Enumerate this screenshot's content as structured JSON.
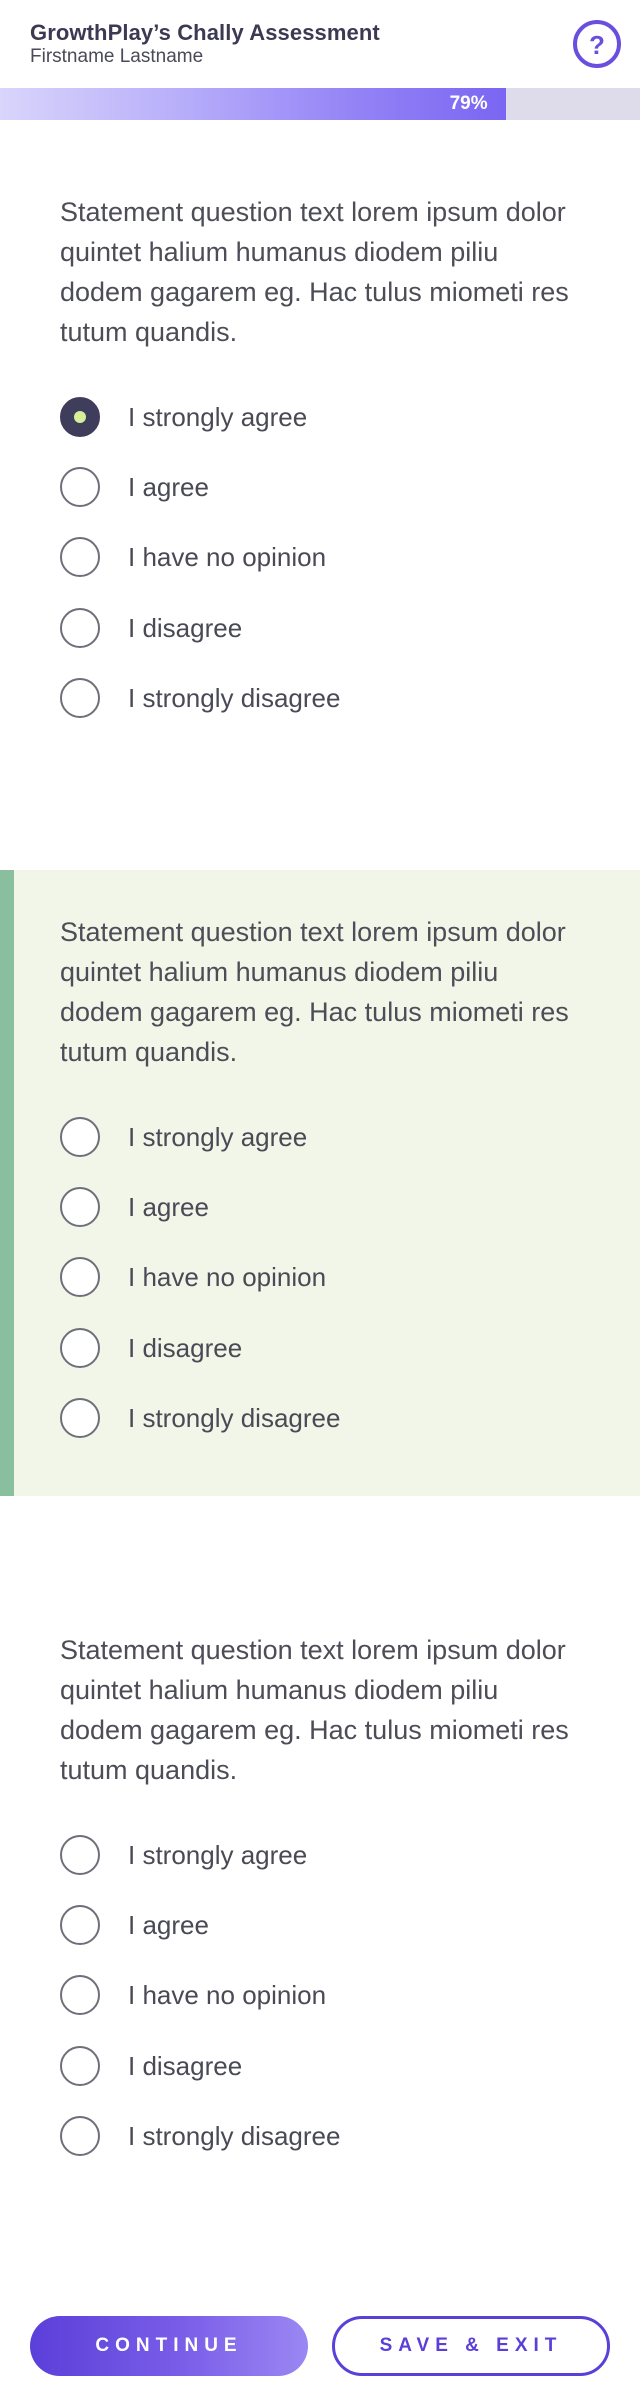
{
  "header": {
    "title": "GrowthPlay’s Chally Assessment",
    "user_name": "Firstname Lastname",
    "help_icon": "question-circle-icon",
    "help_glyph": "?"
  },
  "progress": {
    "value": 0.79,
    "label": "79%"
  },
  "questions": [
    {
      "text": "Statement question text lorem ipsum dolor quintet halium humanus diodem piliu dodem gagarem eg. Hac tulus miometi res tutum quandis.",
      "selected_index": 0,
      "highlighted": false,
      "options": [
        "I strongly agree",
        "I agree",
        "I have no opinion",
        "I disagree",
        "I strongly disagree"
      ]
    },
    {
      "text": "Statement question text lorem ipsum dolor quintet halium humanus diodem piliu dodem gagarem eg. Hac tulus miometi res tutum quandis.",
      "selected_index": null,
      "highlighted": true,
      "options": [
        "I strongly agree",
        "I agree",
        "I have no opinion",
        "I disagree",
        "I strongly disagree"
      ]
    },
    {
      "text": "Statement question text lorem ipsum dolor quintet halium humanus diodem piliu dodem gagarem eg. Hac tulus miometi res tutum quandis.",
      "selected_index": null,
      "highlighted": false,
      "options": [
        "I strongly agree",
        "I agree",
        "I have no opinion",
        "I disagree",
        "I strongly disagree"
      ]
    }
  ],
  "footer": {
    "continue_label": "CONTINUE",
    "save_exit_label": "SAVE & EXIT"
  },
  "colors": {
    "accent": "#5b3fd9",
    "highlight_bg": "#f1f6e9",
    "highlight_bar": "#89bf9d",
    "selected_radio": "#3f3d5c",
    "selected_dot": "#d7ee9a"
  }
}
